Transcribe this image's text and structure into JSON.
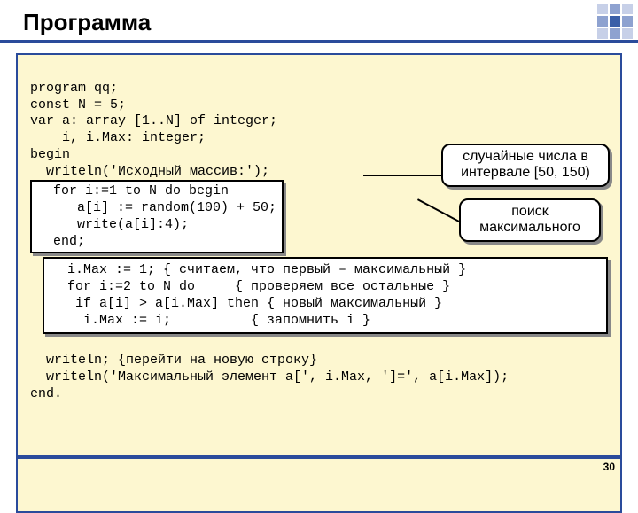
{
  "title": "Программа",
  "code": {
    "l1": "program qq;",
    "l2": "const N = 5;",
    "l3": "var a: array [1..N] of integer;",
    "l4": "    i, i.Max: integer;",
    "l5": "begin",
    "l6": "  writeln('Исходный массив:');",
    "box1": "  for i:=1 to N do begin\n     a[i] := random(100) + 50;\n     write(a[i]:4);\n  end;",
    "box2": "  i.Max := 1; { считаем, что первый – максимальный }\n  for i:=2 to N do     { проверяем все остальные }\n   if a[i] > a[i.Max] then { новый максимальный }\n    i.Max := i;          { запомнить i }",
    "l7": "  writeln; {перейти на новую строку}",
    "l8": "  writeln('Максимальный элемент a[', i.Max, ']=', a[i.Max]);",
    "l9": "end."
  },
  "callouts": {
    "c1": "случайные числа в интервале [50, 150)",
    "c2": "поиск максимального"
  },
  "page_number": "30"
}
